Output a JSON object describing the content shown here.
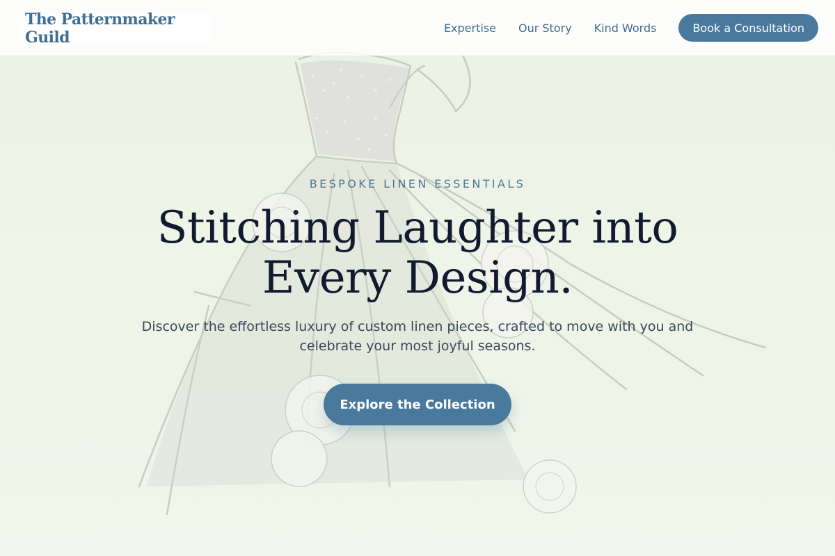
{
  "brand": {
    "name": "The Patternmaker Guild"
  },
  "nav": {
    "links": [
      "Expertise",
      "Our Story",
      "Kind Words"
    ],
    "cta_label": "Book a Consultation"
  },
  "hero": {
    "eyebrow": "BESPOKE LINEN ESSENTIALS",
    "headline": "Stitching Laughter into Every Design.",
    "lede": "Discover the effortless luxury of custom linen pieces, crafted to move with you and celebrate your most joyful seasons.",
    "cta_label": "Explore the Collection"
  },
  "colors": {
    "accent": "#497a9d",
    "headline": "#111a2e",
    "background": "#eef3e6"
  },
  "background_art": "dress-sketch-illustration"
}
